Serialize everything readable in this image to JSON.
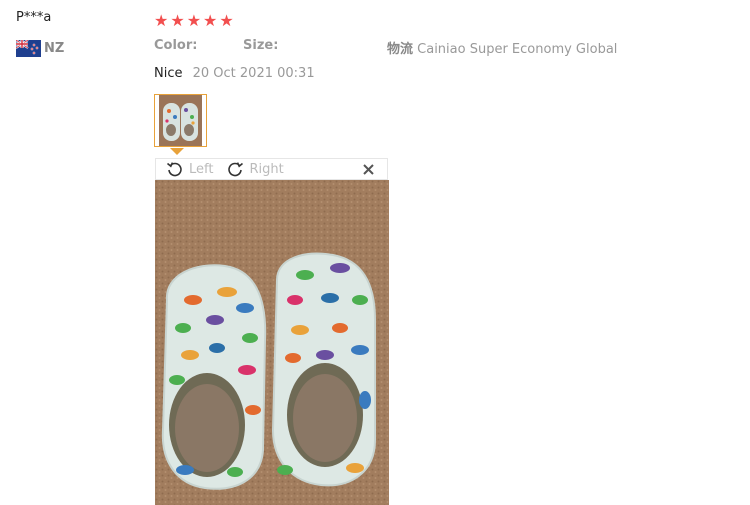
{
  "reviewer": {
    "name": "P***a",
    "country_code": "NZ",
    "flag_icon": "nz-flag-icon"
  },
  "rating": {
    "stars": 5,
    "max": 5,
    "color": "#f24f4f"
  },
  "attributes": {
    "color_label": "Color:",
    "size_label": "Size:",
    "logistics_key": "物流",
    "logistics_value": "Cainiao Super Economy Global"
  },
  "review": {
    "text": "Nice",
    "date": "20 Oct 2021 00:31"
  },
  "viewer": {
    "rotate_left_label": "Left",
    "rotate_right_label": "Right",
    "close_symbol": "×",
    "thumbnail_border_color": "#e8a23a"
  }
}
